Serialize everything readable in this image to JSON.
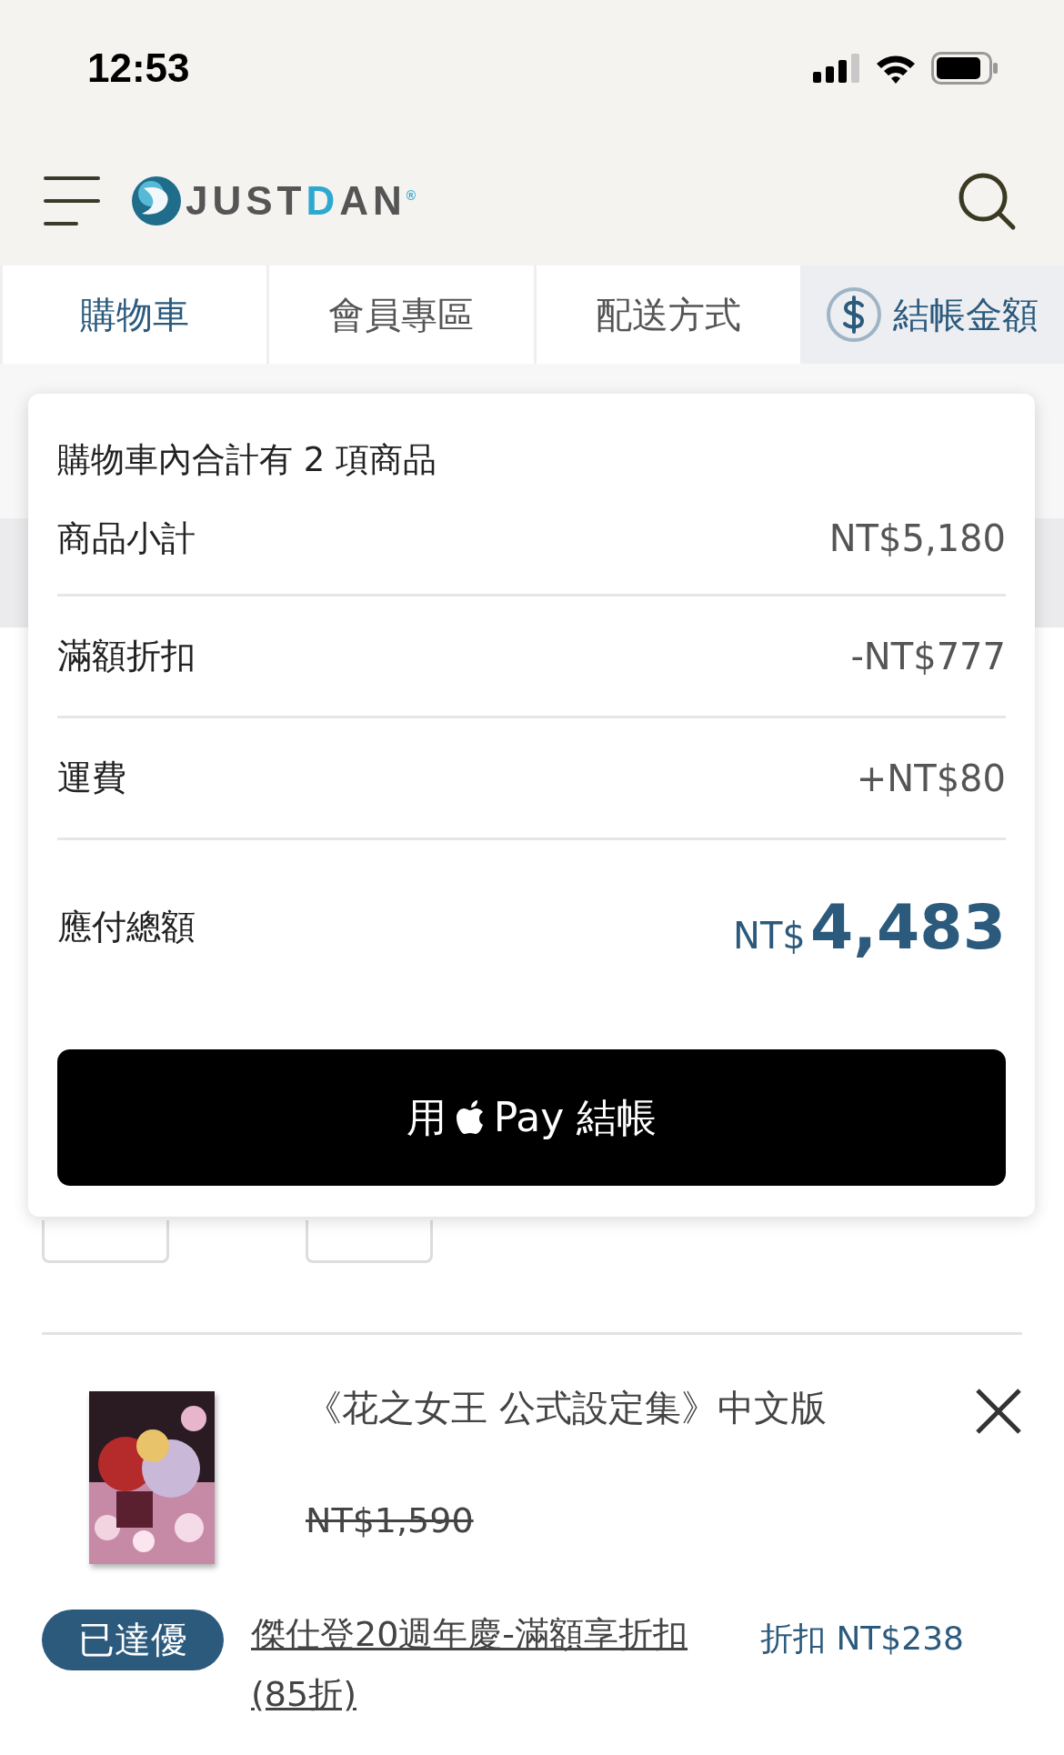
{
  "status_bar": {
    "time": "12:53"
  },
  "header": {
    "logo": {
      "text_dark": "JUST",
      "text_accent": "D",
      "text_rest": "AN",
      "mark": "®"
    }
  },
  "tabs": [
    {
      "label": "購物車",
      "selected": true,
      "kind": "plain"
    },
    {
      "label": "會員專區",
      "selected": false,
      "kind": "plain"
    },
    {
      "label": "配送方式",
      "selected": false,
      "kind": "plain"
    },
    {
      "label": "結帳金額",
      "selected": false,
      "kind": "total"
    }
  ],
  "summary": {
    "title": "購物車內合計有 2 項商品",
    "rows": [
      {
        "label": "商品小計",
        "value": "NT$5,180"
      },
      {
        "label": "滿額折扣",
        "value": "-NT$777"
      },
      {
        "label": "運費",
        "value": "+NT$80"
      }
    ],
    "total": {
      "label": "應付總額",
      "currency": "NT$",
      "amount": "4,483"
    },
    "button": {
      "before": "用",
      "after": "Pay 結帳"
    }
  },
  "item": {
    "title": "《花之女王 公式設定集》中文版",
    "original_price": "NT$1,590",
    "promo": {
      "badge": "已達優",
      "link": "傑仕登20週年慶-滿額享折扣(85折)",
      "discount": "折扣 NT$238"
    }
  }
}
